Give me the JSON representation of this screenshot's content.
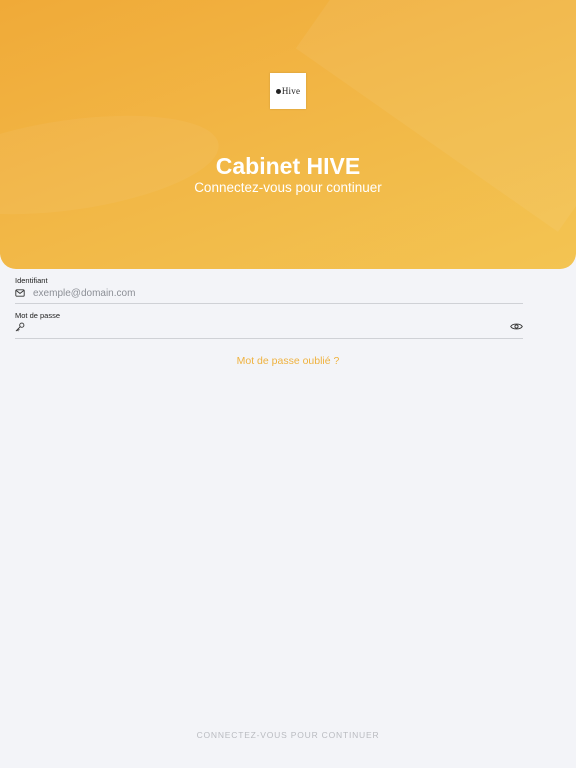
{
  "header": {
    "logo_text": "Hive",
    "title": "Cabinet HIVE",
    "subtitle": "Connectez-vous pour continuer"
  },
  "form": {
    "identifier": {
      "label": "Identifiant",
      "placeholder": "exemple@domain.com",
      "value": "",
      "icon": "mail-icon"
    },
    "password": {
      "label": "Mot de passe",
      "placeholder": "",
      "value": "",
      "icon": "key-icon",
      "toggle_icon": "eye-icon"
    },
    "forgot_password": "Mot de passe oublié ?",
    "submit_label": "CONNECTEZ-VOUS POUR CONTINUER"
  },
  "colors": {
    "accent": "#efb23f",
    "header_gradient_start": "#f0aa38",
    "header_gradient_end": "#f3c452",
    "background": "#f3f4f8",
    "disabled_text": "#b9bbc0"
  }
}
